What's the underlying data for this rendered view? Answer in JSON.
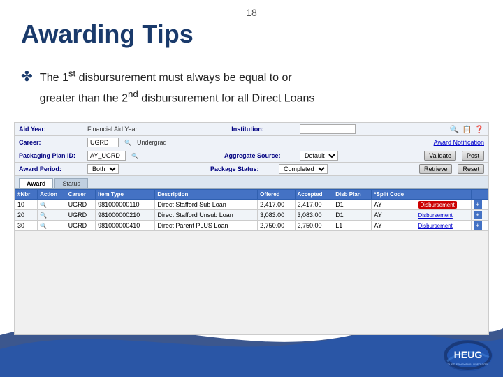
{
  "slide": {
    "page_number": "18",
    "title": "Awarding Tips",
    "bullet": {
      "icon": "✤",
      "line1": "The 1",
      "superscript1": "st",
      "line1b": " disbursurement must always be equal to or",
      "line2": "greater than the 2",
      "superscript2": "nd",
      "line2b": " disbursurement for all Direct Loans"
    },
    "screenshot": {
      "fields": {
        "aid_year_label": "Aid Year:",
        "aid_year_value": "Financial Aid Year",
        "institution_label": "Institution:",
        "career_label": "Career:",
        "career_code": "UGRD",
        "career_text": "Undergrad",
        "packaging_plan_label": "Packaging Plan ID:",
        "packaging_plan_value": "AY_UGRD",
        "aggregate_source_label": "Aggregate Source:",
        "aggregate_source_value": "Default",
        "award_period_label": "Award Period:",
        "award_period_value": "Both",
        "package_status_label": "Package Status:",
        "package_status_value": "Completed",
        "award_notification_link": "Award Notification"
      },
      "buttons": {
        "validate": "Validate",
        "post": "Post",
        "retrieve": "Retrieve",
        "reset": "Reset"
      },
      "tabs": [
        {
          "label": "Award",
          "active": true
        },
        {
          "label": "Status",
          "active": false
        }
      ],
      "table": {
        "columns": [
          "#Nbr",
          "Action",
          "Career",
          "Item Type",
          "Description",
          "Offered",
          "Accepted",
          "Disb Plan",
          "*Split Code",
          "",
          ""
        ],
        "rows": [
          {
            "nbr": "10",
            "action": "",
            "career": "UGRD",
            "item_type": "981000000110",
            "description": "Direct Stafford Sub Loan",
            "offered": "2,417.00",
            "accepted": "2,417.00",
            "disb_plan": "D1",
            "split_code": "AY",
            "link": "Disbursement",
            "highlight": true
          },
          {
            "nbr": "20",
            "action": "",
            "career": "UGRD",
            "item_type": "981000000210",
            "description": "Direct Stafford Unsub Loan",
            "offered": "3,083.00",
            "accepted": "3,083.00",
            "disb_plan": "D1",
            "split_code": "AY",
            "link": "Disbursement",
            "highlight": false
          },
          {
            "nbr": "30",
            "action": "",
            "career": "UGRD",
            "item_type": "981000000410",
            "description": "Direct Parent PLUS Loan",
            "offered": "2,750.00",
            "accepted": "2,750.00",
            "disb_plan": "L1",
            "split_code": "AY",
            "link": "Disbursement",
            "highlight": false
          }
        ]
      }
    }
  }
}
